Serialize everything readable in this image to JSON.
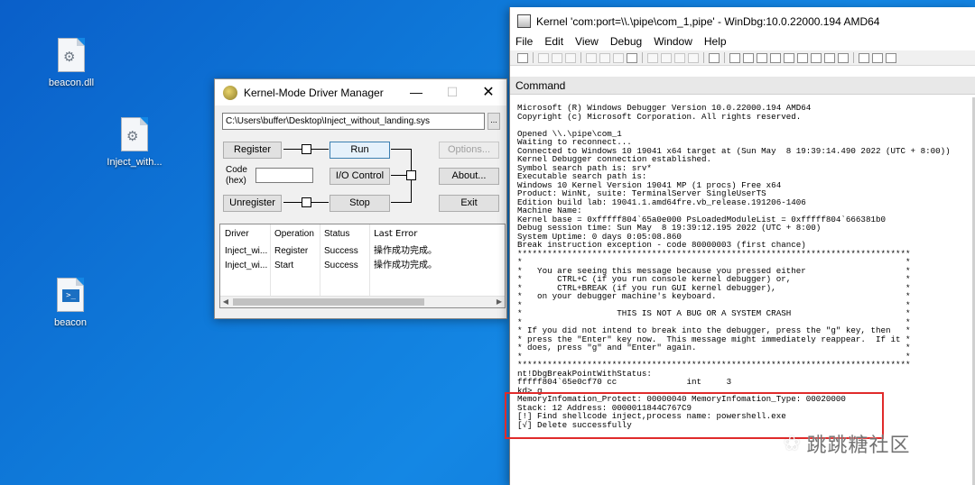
{
  "desktop": {
    "icons": [
      {
        "label": "beacon.dll",
        "icon": "gear-file-icon"
      },
      {
        "label": "Inject_with...",
        "icon": "gear-file-icon"
      },
      {
        "label": "beacon",
        "icon": "powershell-file-icon"
      }
    ]
  },
  "kmdm": {
    "title": "Kernel-Mode Driver Manager",
    "path": "C:\\Users\\buffer\\Desktop\\Inject_without_landing.sys",
    "browse": "...",
    "buttons": {
      "register": "Register",
      "run": "Run",
      "io_control": "I/O Control",
      "unregister": "Unregister",
      "stop": "Stop",
      "options": "Options...",
      "about": "About...",
      "exit": "Exit"
    },
    "code_label": "Code\n(hex)",
    "columns": [
      "Driver",
      "Operation",
      "Status",
      "Last Error"
    ],
    "rows": [
      [
        "Inject_wi...",
        "Register",
        "Success",
        "操作成功完成。"
      ],
      [
        "Inject_wi...",
        "Start",
        "Success",
        "操作成功完成。"
      ]
    ]
  },
  "windbg": {
    "title": "Kernel 'com:port=\\\\.\\pipe\\com_1,pipe' - WinDbg:10.0.22000.194 AMD64",
    "menu": [
      "File",
      "Edit",
      "View",
      "Debug",
      "Window",
      "Help"
    ],
    "command_header": "Command",
    "lines": [
      "Microsoft (R) Windows Debugger Version 10.0.22000.194 AMD64",
      "Copyright (c) Microsoft Corporation. All rights reserved.",
      "",
      "Opened \\\\.\\pipe\\com_1",
      "Waiting to reconnect...",
      "Connected to Windows 10 19041 x64 target at (Sun May  8 19:39:14.490 2022 (UTC + 8:00))",
      "Kernel Debugger connection established.",
      "Symbol search path is: srv*",
      "Executable search path is:",
      "Windows 10 Kernel Version 19041 MP (1 procs) Free x64",
      "Product: WinNt, suite: TerminalServer SingleUserTS",
      "Edition build lab: 19041.1.amd64fre.vb_release.191206-1406",
      "Machine Name:",
      "Kernel base = 0xfffff804`65a0e000 PsLoadedModuleList = 0xfffff804`666381b0",
      "Debug session time: Sun May  8 19:39:12.195 2022 (UTC + 8:00)",
      "System Uptime: 0 days 0:05:08.860",
      "Break instruction exception - code 80000003 (first chance)",
      "*******************************************************************************",
      "*                                                                             *",
      "*   You are seeing this message because you pressed either                    *",
      "*       CTRL+C (if you run console kernel debugger) or,                       *",
      "*       CTRL+BREAK (if you run GUI kernel debugger),                          *",
      "*   on your debugger machine's keyboard.                                      *",
      "*                                                                             *",
      "*                   THIS IS NOT A BUG OR A SYSTEM CRASH                       *",
      "*                                                                             *",
      "* If you did not intend to break into the debugger, press the \"g\" key, then   *",
      "* press the \"Enter\" key now.  This message might immediately reappear.  If it *",
      "* does, press \"g\" and \"Enter\" again.                                          *",
      "*                                                                             *",
      "*******************************************************************************",
      "nt!DbgBreakPointWithStatus:",
      "fffff804`65e0cf70 cc              int     3",
      "kd> g",
      "MemoryInfomation_Protect: 00000040 MemoryInfomation_Type: 00020000",
      "Stack: 12 Address: 0000011844C767C9",
      "[!] Find shellcode inject,process name: powershell.exe",
      "[√] Delete successfully"
    ]
  },
  "watermark": "跳跳糖社区"
}
